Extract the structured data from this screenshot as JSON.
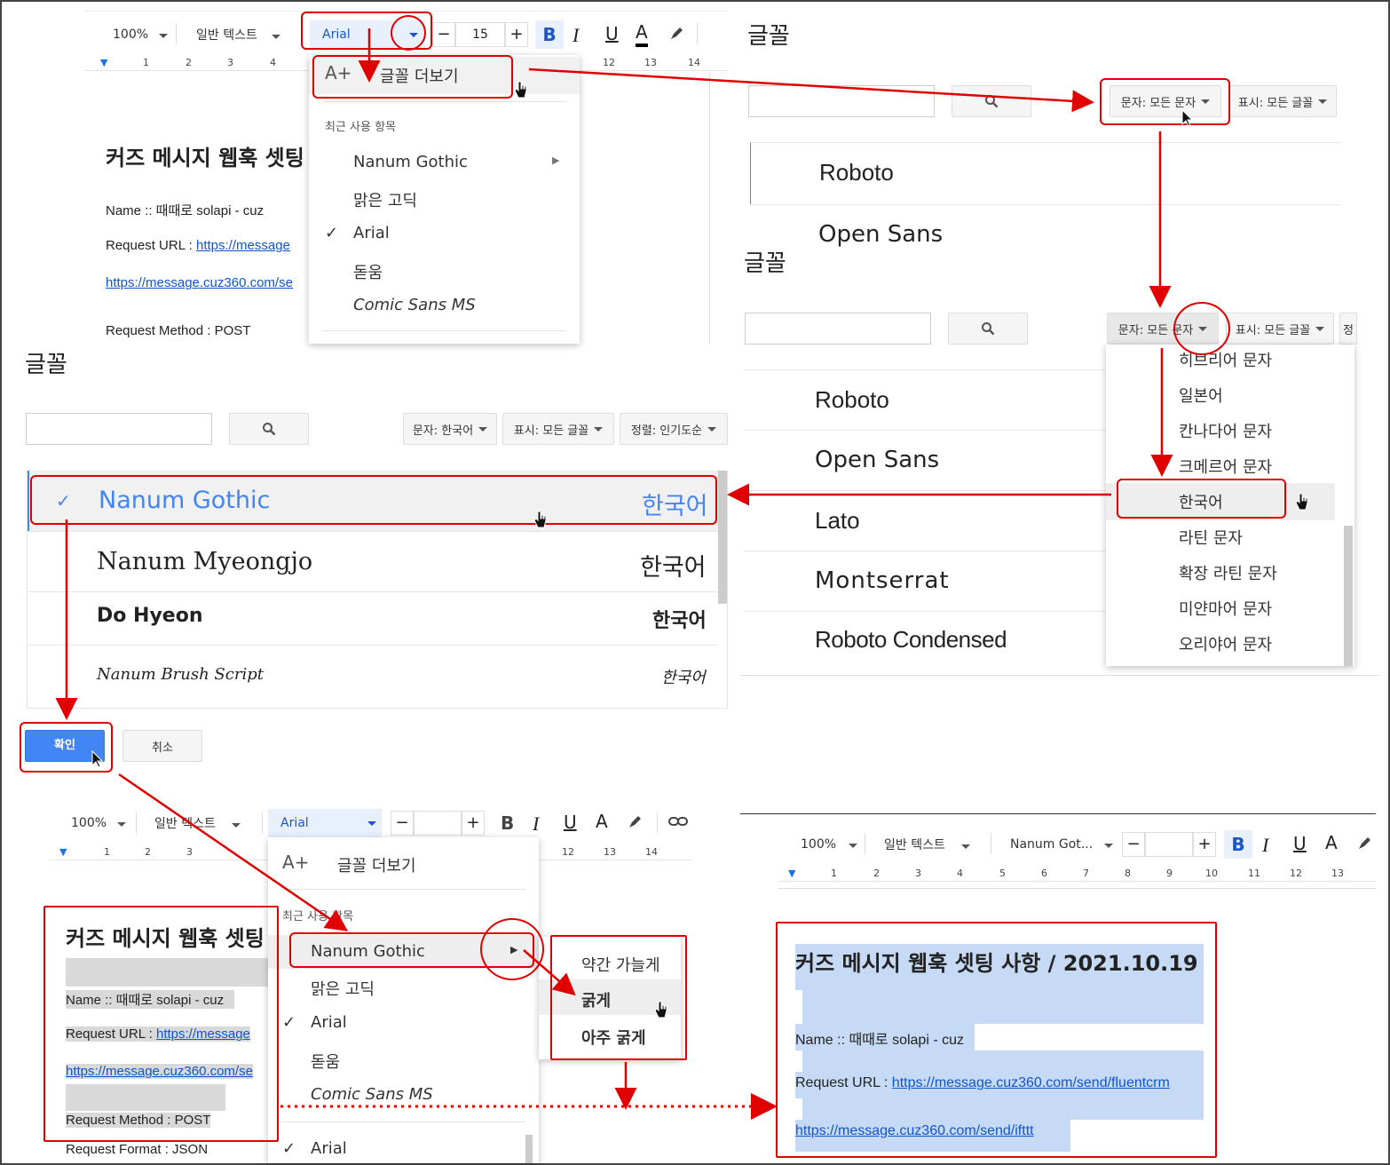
{
  "toolbar1": {
    "zoom": "100%",
    "style": "일반 텍스트",
    "font": "Arial",
    "size": "15",
    "bold": "B",
    "italic": "I",
    "underline": "U",
    "color": "A"
  },
  "ruler1": [
    "1",
    "2",
    "3",
    "4",
    "12",
    "13",
    "14"
  ],
  "menu1": {
    "more_fonts": "글꼴 더보기",
    "recent": "최근 사용 항목",
    "items": [
      "Nanum Gothic",
      "맑은 고딕",
      "Arial",
      "돋움",
      "Comic Sans MS"
    ]
  },
  "doc1": {
    "title": "커즈 메시지 웹훅 셋팅",
    "name": "Name :: 때때로 solapi - cuz",
    "req_label": "Request URL : ",
    "req_link": "https://message",
    "link2": "https://message.cuz360.com/se",
    "method": "Request Method : POST"
  },
  "dialog_a": {
    "heading": "글꼴",
    "script_filter": "문자: 모든 문자",
    "show_filter": "표시: 모든 글꼴",
    "fonts": [
      "Roboto",
      "Open Sans"
    ]
  },
  "dialog_b": {
    "heading": "글꼴",
    "script_filter": "문자: 모든 문자",
    "show_filter": "표시: 모든 글꼴",
    "fonts": [
      "Roboto",
      "Open Sans",
      "Lato",
      "Montserrat",
      "Roboto Condensed"
    ],
    "scripts": [
      "히브리어 문자",
      "일본어",
      "칸나다어 문자",
      "크메르어 문자",
      "한국어",
      "라틴 문자",
      "확장 라틴 문자",
      "미얀마어 문자",
      "오리야어 문자"
    ],
    "edge": "정"
  },
  "dialog_c": {
    "heading": "글꼴",
    "script_filter": "문자: 한국어",
    "show_filter": "표시: 모든 글꼴",
    "sort": "정렬: 인기도순",
    "fonts": [
      {
        "name": "Nanum Gothic",
        "sample": "한국어"
      },
      {
        "name": "Nanum Myeongjo",
        "sample": "한국어"
      },
      {
        "name": "Do Hyeon",
        "sample": "한국어"
      },
      {
        "name": "Nanum Brush Script",
        "sample": "한국어"
      }
    ],
    "ok": "확인",
    "cancel": "취소"
  },
  "toolbar2": {
    "zoom": "100%",
    "style": "일반 텍스트",
    "font": "Arial",
    "bold": "B",
    "italic": "I",
    "underline": "U",
    "color": "A"
  },
  "ruler2": [
    "1",
    "2",
    "3",
    "12",
    "13",
    "14"
  ],
  "menu2": {
    "more_fonts": "글꼴 더보기",
    "recent": "최근 사용 항목",
    "items": [
      "Nanum Gothic",
      "맑은 고딕",
      "Arial",
      "돋움",
      "Comic Sans MS",
      "Arial"
    ],
    "weights": [
      "약간 가늘게",
      "굵게",
      "아주 굵게"
    ]
  },
  "doc2": {
    "title": "커즈 메시지 웹훅 셋팅",
    "name": "Name :: 때때로 solapi - cuz",
    "req_label": "Request URL : ",
    "req_link": "https://message",
    "link2": "https://message.cuz360.com/se",
    "method": "Request Method : POST",
    "format": "Request Format : JSON"
  },
  "toolbar3": {
    "zoom": "100%",
    "style": "일반 텍스트",
    "font": "Nanum Got...",
    "bold": "B",
    "italic": "I",
    "underline": "U",
    "color": "A"
  },
  "ruler3": [
    "1",
    "2",
    "3",
    "4",
    "5",
    "6",
    "7",
    "8",
    "9",
    "10",
    "11",
    "12",
    "13"
  ],
  "doc3": {
    "title": "커즈 메시지 웹훅 셋팅 사항 / 2021.10.19",
    "name": "Name :: 때때로 solapi - cuz",
    "req_label": "Request URL : ",
    "req_link": "https://message.cuz360.com/send/fluentcrm",
    "link2": "https://message.cuz360.com/send/ifttt"
  },
  "colors": {
    "accent_red": "#e00000",
    "link": "#1155cc",
    "google_blue": "#4285f4",
    "highlight": "#c6daf5"
  }
}
